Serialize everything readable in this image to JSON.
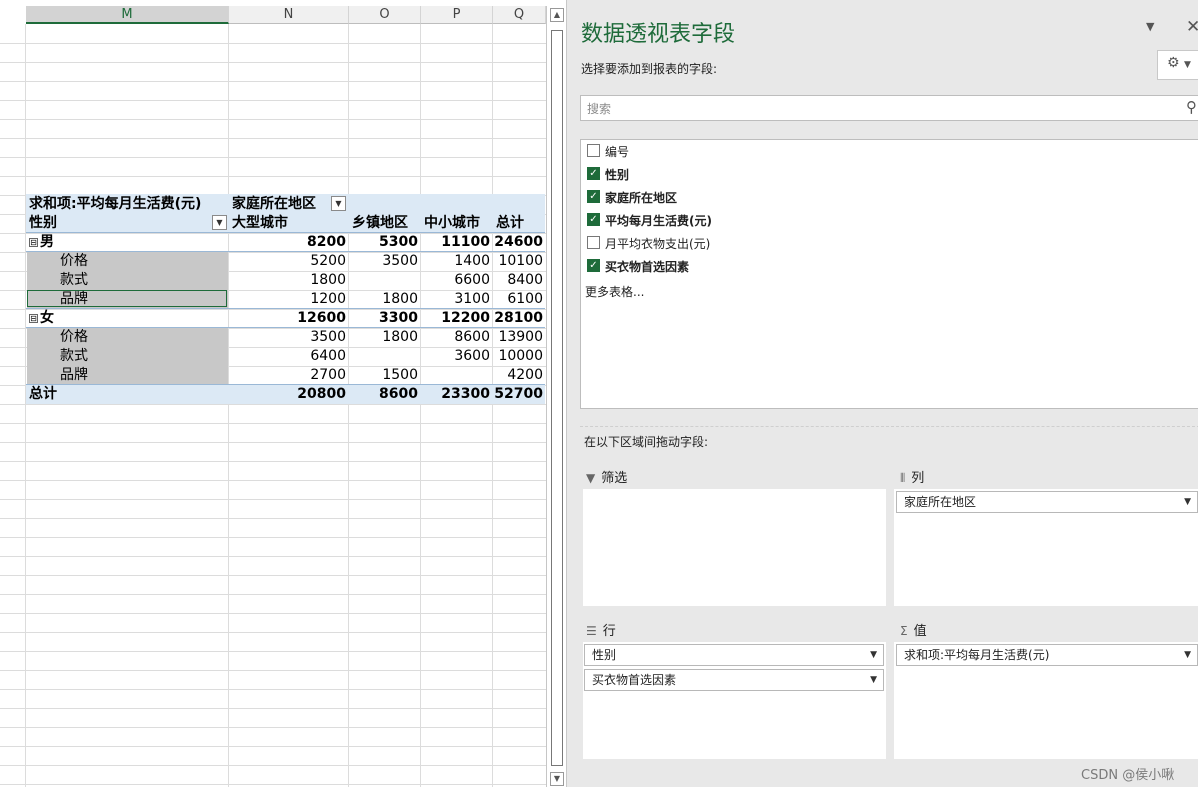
{
  "sheet": {
    "columns": [
      "M",
      "N",
      "O",
      "P",
      "Q"
    ],
    "pivot": {
      "value_field_header": "求和项:平均每月生活费(元)",
      "column_field_header": "家庭所在地区",
      "row_field_header": "性别",
      "column_headers": [
        "大型城市",
        "乡镇地区",
        "中小城市",
        "总计"
      ],
      "groups": [
        {
          "label": "男",
          "collapse": "⊟",
          "values": [
            "8200",
            "5300",
            "11100",
            "24600"
          ],
          "items": [
            {
              "label": "价格",
              "values": [
                "5200",
                "3500",
                "1400",
                "10100"
              ]
            },
            {
              "label": "款式",
              "values": [
                "1800",
                "",
                "6600",
                "8400"
              ]
            },
            {
              "label": "品牌",
              "values": [
                "1200",
                "1800",
                "3100",
                "6100"
              ]
            }
          ]
        },
        {
          "label": "女",
          "collapse": "⊟",
          "values": [
            "12600",
            "3300",
            "12200",
            "28100"
          ],
          "items": [
            {
              "label": "价格",
              "values": [
                "3500",
                "1800",
                "8600",
                "13900"
              ]
            },
            {
              "label": "款式",
              "values": [
                "6400",
                "",
                "3600",
                "10000"
              ]
            },
            {
              "label": "品牌",
              "values": [
                "2700",
                "1500",
                "",
                "4200"
              ]
            }
          ]
        }
      ],
      "grand_total": {
        "label": "总计",
        "values": [
          "20800",
          "8600",
          "23300",
          "52700"
        ]
      }
    }
  },
  "pane": {
    "title": "数据透视表字段",
    "subtitle": "选择要添加到报表的字段:",
    "search_placeholder": "搜索",
    "fields": [
      {
        "label": "编号",
        "checked": false
      },
      {
        "label": "性别",
        "checked": true
      },
      {
        "label": "家庭所在地区",
        "checked": true
      },
      {
        "label": "平均每月生活费(元)",
        "checked": true
      },
      {
        "label": "月平均衣物支出(元)",
        "checked": false
      },
      {
        "label": "买衣物首选因素",
        "checked": true
      }
    ],
    "more_tables": "更多表格...",
    "drag_note": "在以下区域间拖动字段:",
    "areas": {
      "filters": {
        "label": "筛选",
        "icon": "filter-icon",
        "items": []
      },
      "columns": {
        "label": "列",
        "icon": "columns-icon",
        "items": [
          "家庭所在地区"
        ]
      },
      "rows": {
        "label": "行",
        "icon": "rows-icon",
        "items": [
          "性别",
          "买衣物首选因素"
        ]
      },
      "values": {
        "label": "值",
        "icon": "sigma-icon",
        "items": [
          "求和项:平均每月生活费(元)"
        ]
      }
    }
  },
  "watermark": "CSDN @侯小啾",
  "colors": {
    "accent": "#1e6b3a",
    "pivot_header": "#dce9f5",
    "selected_rows": "#c8c8c8"
  }
}
